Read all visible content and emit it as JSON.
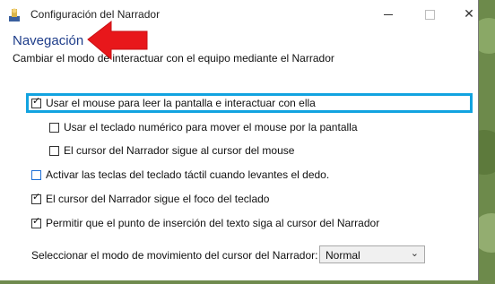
{
  "window": {
    "title": "Configuración del Narrador"
  },
  "page": {
    "heading": "Navegación",
    "subtitle": "Cambiar el modo de interactuar con el equipo mediante el Narrador"
  },
  "options": [
    {
      "label": "Usar el mouse para leer la pantalla e interactuar con ella",
      "checked": true
    },
    {
      "label": "Usar el teclado numérico para mover el mouse por la pantalla",
      "checked": false
    },
    {
      "label": "El cursor del Narrador sigue al cursor del mouse",
      "checked": false
    },
    {
      "label": "Activar las teclas del teclado táctil cuando levantes el dedo.",
      "checked": false
    },
    {
      "label": "El cursor del Narrador sigue el foco del teclado",
      "checked": true
    },
    {
      "label": "Permitir que el punto de inserción del texto siga al cursor del Narrador",
      "checked": true
    }
  ],
  "cursor_mode": {
    "label": "Seleccionar el modo de movimiento del cursor del Narrador:",
    "value": "Normal"
  },
  "colors": {
    "heading": "#1e3d8a",
    "focus_ring": "#12a3e0",
    "annotation_arrow": "#e8171b"
  }
}
